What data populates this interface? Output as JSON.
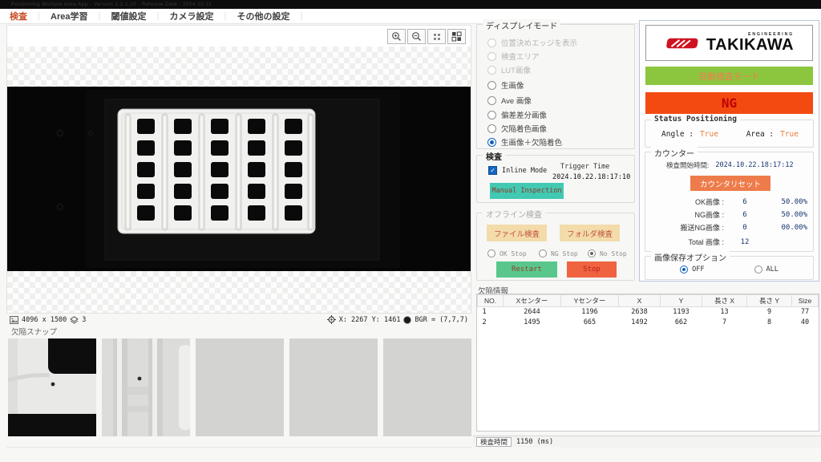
{
  "window_title": "Positioning Multiple Area App - Version 1.2.1.10 - Release Date : 2024.10.11",
  "menu": {
    "tabs": [
      {
        "label": "検査"
      },
      {
        "label": "Area学習"
      },
      {
        "label": "閾値設定"
      },
      {
        "label": "カメラ設定"
      },
      {
        "label": "その他の設定"
      }
    ]
  },
  "viewer": {
    "image_size": "4096 x 1500",
    "layer_count": "3",
    "cursor_pos": "X: 2267 Y: 1461",
    "pixel_value": "BGR = (7,7,7)"
  },
  "display_mode": {
    "title": "ディスプレイモード",
    "options": [
      {
        "label": "位置決めエッジを表示"
      },
      {
        "label": "検査エリア"
      },
      {
        "label": "LUT画像"
      },
      {
        "label": "生画像"
      },
      {
        "label": "Ave 画像"
      },
      {
        "label": "偏差差分画像"
      },
      {
        "label": "欠陥着色画像"
      },
      {
        "label": "生画像＋欠陥着色"
      }
    ],
    "selected": "生画像＋欠陥着色"
  },
  "inspection": {
    "title": "検査",
    "inline_mode_label": "Inline Mode",
    "trigger_time_label": "Trigger Time",
    "trigger_time": "2024.10.22.18:17:10",
    "manual_button": "Manual Inspection"
  },
  "offline": {
    "title": "オフライン検査",
    "file_button": "ファイル検査",
    "folder_button": "フォルダ検査",
    "stop_options": [
      {
        "label": "OK Stop"
      },
      {
        "label": "NG Stop"
      },
      {
        "label": "No Stop"
      }
    ],
    "selected_stop": "No Stop",
    "restart_button": "Restart",
    "stop_button": "Stop"
  },
  "panel": {
    "brand_sub": "ENGINEERING",
    "brand": "TAKIKAWA",
    "mode_banner": "自動検査モード",
    "result": "NG",
    "positioning": {
      "title": "Status Positioning",
      "angle_label": "Angle :",
      "angle_value": "True",
      "area_label": "Area :",
      "area_value": "True"
    },
    "counter": {
      "title": "カウンター",
      "start_time_label": "検査開始時間:",
      "start_time": "2024.10.22.18:17:12",
      "reset_button": "カウンタリセット",
      "rows": [
        {
          "label": "OK画像 :",
          "value": "6",
          "percent": "50.00%"
        },
        {
          "label": "NG画像 :",
          "value": "6",
          "percent": "50.00%"
        },
        {
          "label": "搬送NG画像 :",
          "value": "0",
          "percent": "00.00%"
        }
      ],
      "total_label": "Total 画像 :",
      "total_value": "12"
    },
    "save_option": {
      "title": "画像保存オプション",
      "options": [
        {
          "label": "OFF"
        },
        {
          "label": "ALL"
        }
      ],
      "selected": "OFF"
    }
  },
  "defects": {
    "title": "欠陥情報",
    "headers": [
      "NO.",
      "Xセンター",
      "Yセンター",
      "X",
      "Y",
      "長さ X",
      "長さ Y",
      "Size"
    ],
    "rows": [
      [
        "1",
        "2644",
        "1196",
        "2638",
        "1193",
        "13",
        "9",
        "77"
      ],
      [
        "2",
        "1495",
        "665",
        "1492",
        "662",
        "7",
        "8",
        "40"
      ]
    ]
  },
  "snapshots": {
    "title": "欠陥スナップ"
  },
  "footer": {
    "time_label": "検査時間",
    "time_value": "1150 (ms)"
  }
}
